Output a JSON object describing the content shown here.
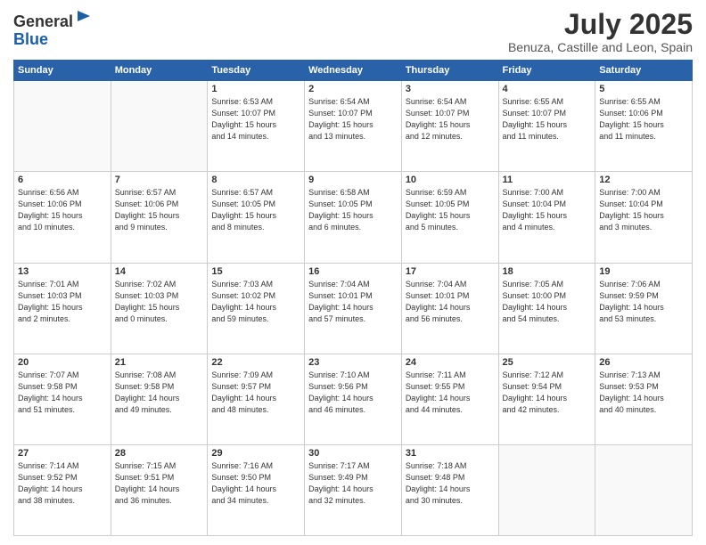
{
  "header": {
    "logo_line1": "General",
    "logo_line2": "Blue",
    "month_year": "July 2025",
    "location": "Benuza, Castille and Leon, Spain"
  },
  "weekdays": [
    "Sunday",
    "Monday",
    "Tuesday",
    "Wednesday",
    "Thursday",
    "Friday",
    "Saturday"
  ],
  "weeks": [
    [
      {
        "day": "",
        "info": ""
      },
      {
        "day": "",
        "info": ""
      },
      {
        "day": "1",
        "info": "Sunrise: 6:53 AM\nSunset: 10:07 PM\nDaylight: 15 hours\nand 14 minutes."
      },
      {
        "day": "2",
        "info": "Sunrise: 6:54 AM\nSunset: 10:07 PM\nDaylight: 15 hours\nand 13 minutes."
      },
      {
        "day": "3",
        "info": "Sunrise: 6:54 AM\nSunset: 10:07 PM\nDaylight: 15 hours\nand 12 minutes."
      },
      {
        "day": "4",
        "info": "Sunrise: 6:55 AM\nSunset: 10:07 PM\nDaylight: 15 hours\nand 11 minutes."
      },
      {
        "day": "5",
        "info": "Sunrise: 6:55 AM\nSunset: 10:06 PM\nDaylight: 15 hours\nand 11 minutes."
      }
    ],
    [
      {
        "day": "6",
        "info": "Sunrise: 6:56 AM\nSunset: 10:06 PM\nDaylight: 15 hours\nand 10 minutes."
      },
      {
        "day": "7",
        "info": "Sunrise: 6:57 AM\nSunset: 10:06 PM\nDaylight: 15 hours\nand 9 minutes."
      },
      {
        "day": "8",
        "info": "Sunrise: 6:57 AM\nSunset: 10:05 PM\nDaylight: 15 hours\nand 8 minutes."
      },
      {
        "day": "9",
        "info": "Sunrise: 6:58 AM\nSunset: 10:05 PM\nDaylight: 15 hours\nand 6 minutes."
      },
      {
        "day": "10",
        "info": "Sunrise: 6:59 AM\nSunset: 10:05 PM\nDaylight: 15 hours\nand 5 minutes."
      },
      {
        "day": "11",
        "info": "Sunrise: 7:00 AM\nSunset: 10:04 PM\nDaylight: 15 hours\nand 4 minutes."
      },
      {
        "day": "12",
        "info": "Sunrise: 7:00 AM\nSunset: 10:04 PM\nDaylight: 15 hours\nand 3 minutes."
      }
    ],
    [
      {
        "day": "13",
        "info": "Sunrise: 7:01 AM\nSunset: 10:03 PM\nDaylight: 15 hours\nand 2 minutes."
      },
      {
        "day": "14",
        "info": "Sunrise: 7:02 AM\nSunset: 10:03 PM\nDaylight: 15 hours\nand 0 minutes."
      },
      {
        "day": "15",
        "info": "Sunrise: 7:03 AM\nSunset: 10:02 PM\nDaylight: 14 hours\nand 59 minutes."
      },
      {
        "day": "16",
        "info": "Sunrise: 7:04 AM\nSunset: 10:01 PM\nDaylight: 14 hours\nand 57 minutes."
      },
      {
        "day": "17",
        "info": "Sunrise: 7:04 AM\nSunset: 10:01 PM\nDaylight: 14 hours\nand 56 minutes."
      },
      {
        "day": "18",
        "info": "Sunrise: 7:05 AM\nSunset: 10:00 PM\nDaylight: 14 hours\nand 54 minutes."
      },
      {
        "day": "19",
        "info": "Sunrise: 7:06 AM\nSunset: 9:59 PM\nDaylight: 14 hours\nand 53 minutes."
      }
    ],
    [
      {
        "day": "20",
        "info": "Sunrise: 7:07 AM\nSunset: 9:58 PM\nDaylight: 14 hours\nand 51 minutes."
      },
      {
        "day": "21",
        "info": "Sunrise: 7:08 AM\nSunset: 9:58 PM\nDaylight: 14 hours\nand 49 minutes."
      },
      {
        "day": "22",
        "info": "Sunrise: 7:09 AM\nSunset: 9:57 PM\nDaylight: 14 hours\nand 48 minutes."
      },
      {
        "day": "23",
        "info": "Sunrise: 7:10 AM\nSunset: 9:56 PM\nDaylight: 14 hours\nand 46 minutes."
      },
      {
        "day": "24",
        "info": "Sunrise: 7:11 AM\nSunset: 9:55 PM\nDaylight: 14 hours\nand 44 minutes."
      },
      {
        "day": "25",
        "info": "Sunrise: 7:12 AM\nSunset: 9:54 PM\nDaylight: 14 hours\nand 42 minutes."
      },
      {
        "day": "26",
        "info": "Sunrise: 7:13 AM\nSunset: 9:53 PM\nDaylight: 14 hours\nand 40 minutes."
      }
    ],
    [
      {
        "day": "27",
        "info": "Sunrise: 7:14 AM\nSunset: 9:52 PM\nDaylight: 14 hours\nand 38 minutes."
      },
      {
        "day": "28",
        "info": "Sunrise: 7:15 AM\nSunset: 9:51 PM\nDaylight: 14 hours\nand 36 minutes."
      },
      {
        "day": "29",
        "info": "Sunrise: 7:16 AM\nSunset: 9:50 PM\nDaylight: 14 hours\nand 34 minutes."
      },
      {
        "day": "30",
        "info": "Sunrise: 7:17 AM\nSunset: 9:49 PM\nDaylight: 14 hours\nand 32 minutes."
      },
      {
        "day": "31",
        "info": "Sunrise: 7:18 AM\nSunset: 9:48 PM\nDaylight: 14 hours\nand 30 minutes."
      },
      {
        "day": "",
        "info": ""
      },
      {
        "day": "",
        "info": ""
      }
    ]
  ]
}
